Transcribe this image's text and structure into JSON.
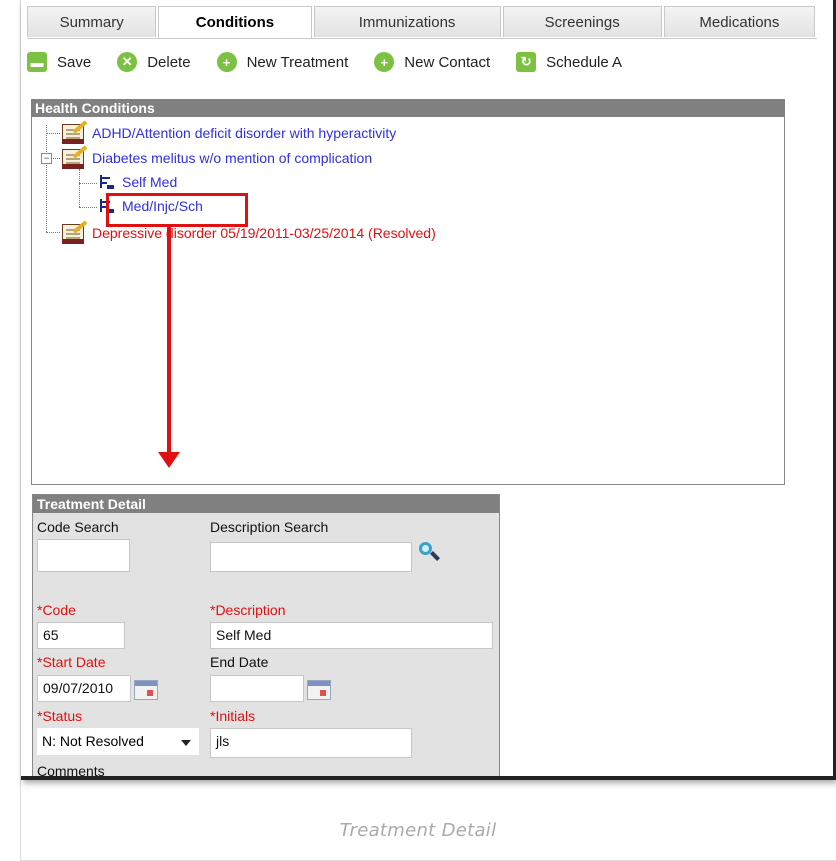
{
  "tabs": [
    {
      "label": "Summary",
      "active": false
    },
    {
      "label": "Conditions",
      "active": true
    },
    {
      "label": "Immunizations",
      "active": false
    },
    {
      "label": "Screenings",
      "active": false
    },
    {
      "label": "Medications",
      "active": false
    }
  ],
  "toolbar": {
    "save": "Save",
    "delete": "Delete",
    "new_treatment": "New Treatment",
    "new_contact": "New Contact",
    "schedule": "Schedule A"
  },
  "health_conditions": {
    "title": "Health Conditions",
    "items": [
      {
        "label": "ADHD/Attention deficit disorder with hyperactivity",
        "color": "#3030e0"
      },
      {
        "label": "Diabetes melitus w/o mention of complication",
        "color": "#3030e0",
        "treatments": [
          "Self Med",
          "Med/Injc/Sch"
        ]
      },
      {
        "label": "Depressive disorder 05/19/2011-03/25/2014 (Resolved)",
        "color": "#e01010"
      }
    ],
    "expander": "−"
  },
  "treatment_detail": {
    "title": "Treatment Detail",
    "code_search_label": "Code Search",
    "description_search_label": "Description Search",
    "code_label": "*Code",
    "code_value": "65",
    "description_label": "*Description",
    "description_value": "Self Med",
    "start_date_label": "*Start Date",
    "start_date_value": "09/07/2010",
    "end_date_label": "End Date",
    "end_date_value": "",
    "status_label": "*Status",
    "status_value": "N: Not Resolved",
    "initials_label": "*Initials",
    "initials_value": "jls",
    "comments_label": "Comments"
  },
  "caption": "Treatment Detail",
  "colors": {
    "accent_green": "#7cc142",
    "annotation_red": "#e01010",
    "link_blue": "#3030e0"
  }
}
